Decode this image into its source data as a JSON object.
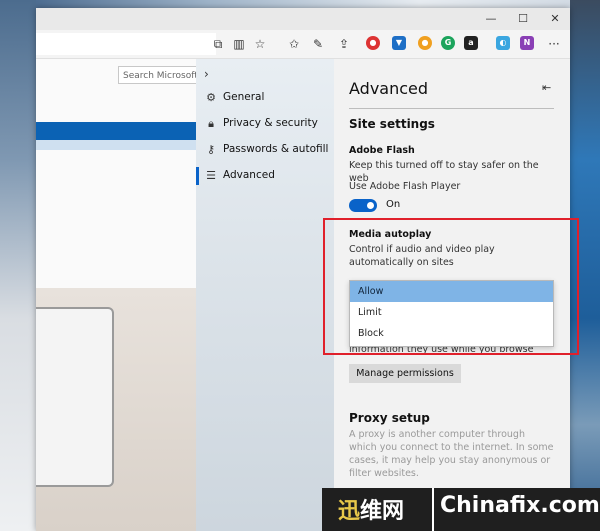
{
  "window": {
    "controls": {
      "minimize": "—",
      "maximize": "☐",
      "close": "✕"
    }
  },
  "toolbar": {
    "icons": [
      "reading-view-icon",
      "favorite-star-icon",
      "favorites-hub-icon",
      "pen-icon",
      "share-icon",
      "more-icon"
    ],
    "more_label": "···"
  },
  "page": {
    "search_placeholder": "Search Microsoft"
  },
  "nav": {
    "chevron": "›",
    "items": [
      {
        "label": "General",
        "icon": "gear-icon"
      },
      {
        "label": "Privacy & security",
        "icon": "lock-icon"
      },
      {
        "label": "Passwords & autofill",
        "icon": "key-icon"
      },
      {
        "label": "Advanced",
        "icon": "sliders-icon",
        "active": true
      }
    ]
  },
  "panel": {
    "title": "Advanced",
    "site_settings": "Site settings",
    "flash": {
      "heading": "Adobe Flash",
      "description": "Keep this turned off to stay safer on the web",
      "toggle_label": "Use Adobe Flash Player",
      "toggle_state": "On"
    },
    "media": {
      "heading": "Media autoplay",
      "description": "Control if audio and video play automatically on sites",
      "options": [
        "Allow",
        "Limit",
        "Block"
      ],
      "selected": "Allow",
      "partial_text": "information they use while you browse"
    },
    "manage_permissions": "Manage permissions",
    "proxy": {
      "heading": "Proxy setup",
      "description": "A proxy is another computer through which you connect to the internet. In some cases, it may help you stay anonymous or filter websites."
    }
  },
  "watermark": {
    "chinese_prefix": "迅",
    "chinese_rest": "维网",
    "english": "Chinafix.com"
  },
  "colors": {
    "accent": "#0a63c9",
    "selected_option": "#7fb4e6",
    "highlight": "#e0202b"
  }
}
